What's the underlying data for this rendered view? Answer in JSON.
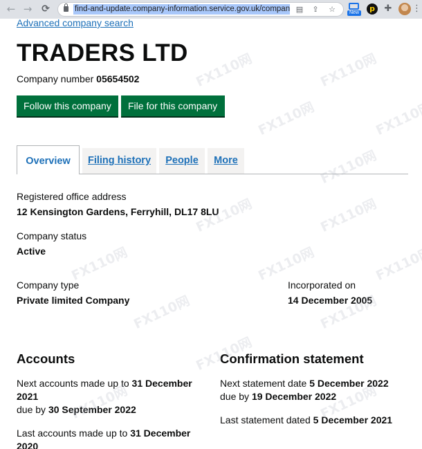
{
  "browser": {
    "url": "find-and-update.company-information.service.gov.uk/compan",
    "back_icon": "←",
    "forward_icon": "→",
    "reload_icon": "C",
    "ext_new_label": "New"
  },
  "page": {
    "advanced_search_link": "Advanced company search",
    "company_name": "TRADERS LTD",
    "company_number_label": "Company number",
    "company_number": "05654502",
    "follow_button": "Follow this company",
    "file_button": "File for this company",
    "tabs": [
      {
        "label": "Overview",
        "selected": true
      },
      {
        "label": "Filing history",
        "selected": false
      },
      {
        "label": "People",
        "selected": false
      },
      {
        "label": "More",
        "selected": false
      }
    ],
    "registered_office": {
      "label": "Registered office address",
      "value": "12 Kensington Gardens, Ferryhill, DL17 8LU"
    },
    "company_status": {
      "label": "Company status",
      "value": "Active"
    },
    "company_type": {
      "label": "Company type",
      "value": "Private limited Company"
    },
    "incorporated": {
      "label": "Incorporated on",
      "value": "14 December 2005"
    },
    "accounts": {
      "heading": "Accounts",
      "next_prefix": "Next accounts made up to",
      "next_date": "31 December 2021",
      "due_prefix": "due by",
      "due_date": "30 September 2022",
      "last_prefix": "Last accounts made up to",
      "last_date": "31 December 2020"
    },
    "confirmation": {
      "heading": "Confirmation statement",
      "next_prefix": "Next statement date",
      "next_date": "5 December 2022",
      "due_prefix": "due by",
      "due_date": "19 December 2022",
      "last_prefix": "Last statement dated",
      "last_date": "5 December 2021"
    }
  },
  "watermark_text": "FX110网"
}
